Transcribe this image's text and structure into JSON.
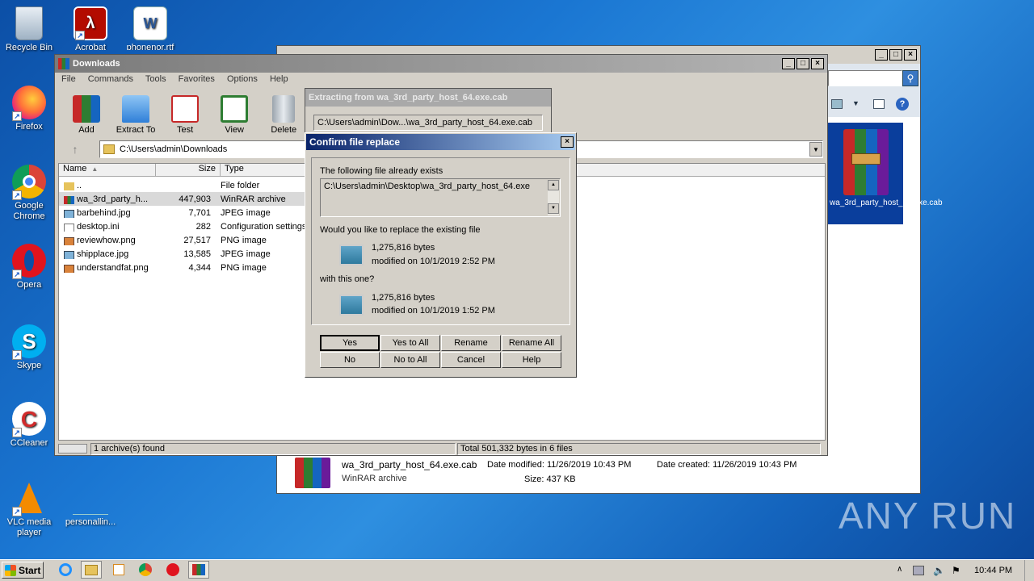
{
  "desktop": {
    "icons": [
      {
        "label": "Recycle Bin",
        "icon": "recycle-bin-icon"
      },
      {
        "label": "Acrobat",
        "icon": "acrobat-icon"
      },
      {
        "label": "phonenor.rtf",
        "icon": "word-doc-icon"
      },
      {
        "label": "Firefox",
        "icon": "firefox-icon"
      },
      {
        "label": "Google Chrome",
        "icon": "chrome-icon"
      },
      {
        "label": "Opera",
        "icon": "opera-icon"
      },
      {
        "label": "Skype",
        "icon": "skype-icon"
      },
      {
        "label": "CCleaner",
        "icon": "ccleaner-icon"
      },
      {
        "label": "VLC media player",
        "icon": "vlc-icon"
      },
      {
        "label": "personallin...",
        "icon": "file-icon"
      }
    ],
    "watermark": "ANY RUN"
  },
  "explorer": {
    "title": "Downloads",
    "file_label": "wa_3rd_party_host_64.exe.cab",
    "details": {
      "name": "wa_3rd_party_host_64.exe.cab",
      "type": "WinRAR archive",
      "date_modified": "Date modified: 11/26/2019 10:43 PM",
      "date_created": "Date created: 11/26/2019 10:43 PM",
      "size": "Size: 437 KB"
    }
  },
  "winrar": {
    "title": "Downloads",
    "menu": [
      "File",
      "Commands",
      "Tools",
      "Favorites",
      "Options",
      "Help"
    ],
    "toolbar": [
      "Add",
      "Extract To",
      "Test",
      "View",
      "Delete"
    ],
    "path": "C:\\Users\\admin\\Downloads",
    "columns": [
      "Name",
      "Size",
      "Type"
    ],
    "files": [
      {
        "name": "..",
        "size": "",
        "type": "File folder"
      },
      {
        "name": "wa_3rd_party_h...",
        "size": "447,903",
        "type": "WinRAR archive"
      },
      {
        "name": "barbehind.jpg",
        "size": "7,701",
        "type": "JPEG image"
      },
      {
        "name": "desktop.ini",
        "size": "282",
        "type": "Configuration settings"
      },
      {
        "name": "reviewhow.png",
        "size": "27,517",
        "type": "PNG image"
      },
      {
        "name": "shipplace.jpg",
        "size": "13,585",
        "type": "JPEG image"
      },
      {
        "name": "understandfat.png",
        "size": "4,344",
        "type": "PNG image"
      }
    ],
    "status_left": "1 archive(s) found",
    "status_right": "Total 501,332 bytes in 6 files"
  },
  "extract": {
    "title": "Extracting from wa_3rd_party_host_64.exe.cab",
    "path": "C:\\Users\\admin\\Dow...\\wa_3rd_party_host_64.exe.cab"
  },
  "confirm": {
    "title": "Confirm file replace",
    "exists_label": "The following file already exists",
    "existing_path": "C:\\Users\\admin\\Desktop\\wa_3rd_party_host_64.exe",
    "question": "Would you like to replace the existing file",
    "existing_size": "1,275,816 bytes",
    "existing_modified": "modified on 10/1/2019 2:52 PM",
    "with_label": "with this one?",
    "new_size": "1,275,816 bytes",
    "new_modified": "modified on 10/1/2019 1:52 PM",
    "buttons": [
      "Yes",
      "Yes to All",
      "Rename",
      "Rename All",
      "No",
      "No to All",
      "Cancel",
      "Help"
    ]
  },
  "taskbar": {
    "start": "Start",
    "clock": "10:44 PM"
  }
}
